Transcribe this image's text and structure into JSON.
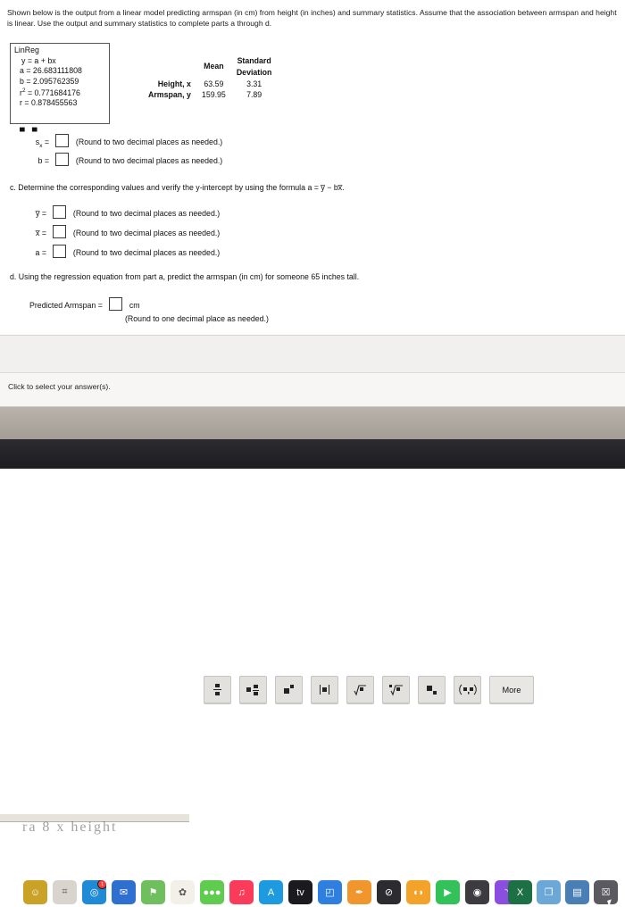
{
  "problem": {
    "statement": "Shown below is the output from a linear model predicting armspan (in cm) from height (in inches) and summary statistics. Assume that the association between armspan and height is linear. Use the output and summary statistics to complete parts a through d."
  },
  "calculator_output": {
    "title": "LinReg",
    "lines": [
      "y = a + bx",
      "a = 26.683111808",
      "b = 2.095762359",
      "r² = 0.771684176",
      "r = 0.878455563"
    ],
    "equation": "y = a + bx",
    "a": "26.683111808",
    "b": "2.095762359",
    "r2": "0.771684176",
    "r": "0.878455563"
  },
  "summary_stats": {
    "col_headers": [
      "Mean",
      "Standard Deviation"
    ],
    "header_mean": "Mean",
    "header_sd_line1": "Standard",
    "header_sd_line2": "Deviation",
    "rows": [
      {
        "label": "Height, x",
        "mean": "63.59",
        "sd": "3.31"
      },
      {
        "label": "Armspan, y",
        "mean": "159.95",
        "sd": "7.89"
      }
    ]
  },
  "answers": {
    "round_two": "(Round to two decimal places as needed.)",
    "round_one": "(Round to one decimal place as needed.)",
    "partial_rows": [
      {
        "label": "s",
        "sub": "x",
        "eq": "="
      },
      {
        "label": "b",
        "sub": "",
        "eq": "="
      }
    ],
    "sx_label": "s",
    "sx_sub": "x",
    "b_label": "b",
    "part_c_text": "c. Determine the corresponding values and verify the y-intercept by using the formula a = y̅ − bx̅.",
    "part_c_rows": [
      {
        "label": "y̅",
        "eq": "="
      },
      {
        "label": "x̅",
        "eq": "="
      },
      {
        "label": "a",
        "eq": "="
      }
    ],
    "part_d_text": "d. Using the regression equation from part a, predict the armspan (in cm) for someone 65 inches tall.",
    "predicted_label": "Predicted Armspan =",
    "predicted_unit": "cm",
    "overlap_artifact": "ⁿ"
  },
  "math_palette": {
    "buttons": [
      {
        "name": "fraction-stack-button",
        "glyph": "‖"
      },
      {
        "name": "mixed-number-button",
        "glyph": "▪▎"
      },
      {
        "name": "exponent-button",
        "glyph": "▪ˣ"
      },
      {
        "name": "absolute-value-button",
        "glyph": "|▪|"
      },
      {
        "name": "square-root-button",
        "glyph": "√▪"
      },
      {
        "name": "nth-root-button",
        "glyph": "ⁿ√▪"
      },
      {
        "name": "subscript-button",
        "glyph": "▪ₙ"
      },
      {
        "name": "interval-button",
        "glyph": "(▪,▪)"
      }
    ],
    "more_label": "More"
  },
  "footer": {
    "hint": "Click to select your answer(s)."
  },
  "desk_text": "ra 8 x height",
  "dock": {
    "items": [
      {
        "name": "dock-finder",
        "glyph": "☺",
        "color": "#c9a227",
        "badge": ""
      },
      {
        "name": "dock-launchpad",
        "glyph": "⌗",
        "color": "#d9d4cc",
        "badge": ""
      },
      {
        "name": "dock-safari",
        "glyph": "◎",
        "color": "#1f8bd6",
        "badge": "1"
      },
      {
        "name": "dock-mail",
        "glyph": "✉",
        "color": "#2f6fd0",
        "badge": ""
      },
      {
        "name": "dock-maps",
        "glyph": "⚑",
        "color": "#6fbf5e",
        "badge": ""
      },
      {
        "name": "dock-photos",
        "glyph": "✿",
        "color": "#f3f0ea",
        "badge": ""
      },
      {
        "name": "dock-messages",
        "glyph": "●●●",
        "color": "#5fcc4f",
        "badge": ""
      },
      {
        "name": "dock-music",
        "glyph": "♫",
        "color": "#fa3c5a",
        "badge": ""
      },
      {
        "name": "dock-app-store",
        "glyph": "A",
        "color": "#1e9ae0",
        "badge": ""
      },
      {
        "name": "dock-tv",
        "glyph": "tv",
        "color": "#1b1b1f",
        "badge": ""
      },
      {
        "name": "dock-keynote",
        "glyph": "◰",
        "color": "#2f7fe0",
        "badge": ""
      },
      {
        "name": "dock-pages",
        "glyph": "✒",
        "color": "#f0962c",
        "badge": ""
      },
      {
        "name": "dock-do-not-enter",
        "glyph": "⊘",
        "color": "#2b2b30",
        "badge": ""
      },
      {
        "name": "dock-books",
        "glyph": "◖◗",
        "color": "#f4a32a",
        "badge": ""
      },
      {
        "name": "dock-facetime",
        "glyph": "▶",
        "color": "#33c15a",
        "badge": ""
      },
      {
        "name": "dock-record",
        "glyph": "◉",
        "color": "#3b3b40",
        "badge": ""
      },
      {
        "name": "dock-podcasts",
        "glyph": "◝",
        "color": "#8c4ee0",
        "badge": ""
      }
    ],
    "right_items": [
      {
        "name": "dock-excel",
        "glyph": "X",
        "color": "#1d7044",
        "badge": ""
      },
      {
        "name": "dock-preview",
        "glyph": "❐",
        "color": "#6ba8d8",
        "badge": ""
      },
      {
        "name": "dock-files",
        "glyph": "▤",
        "color": "#4a7fb5",
        "badge": ""
      },
      {
        "name": "dock-trash",
        "glyph": "☒",
        "color": "#5a5a60",
        "badge": ""
      }
    ]
  }
}
